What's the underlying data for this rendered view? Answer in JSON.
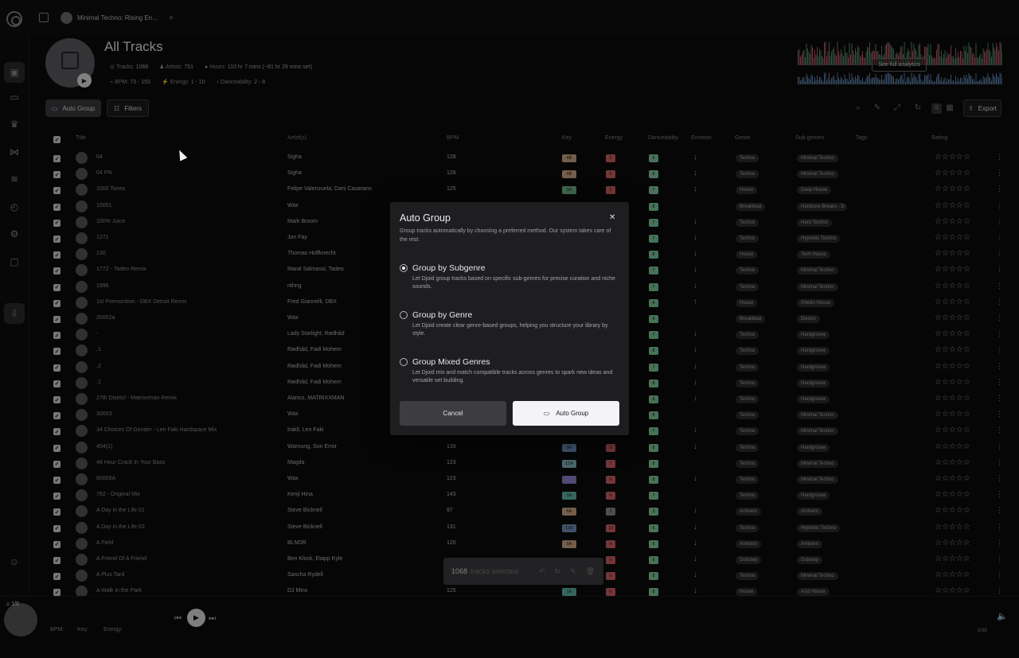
{
  "tab": {
    "label": "Minimal Techno: Rising En..."
  },
  "header": {
    "title": "All Tracks",
    "tracks_label": "Tracks:",
    "tracks": "1068",
    "artists_label": "Artists:",
    "artists": "751",
    "hours_label": "Hours:",
    "hours": "110 hr 7 mins (~81 hr 29 mins set)",
    "bpm_label": "BPM:",
    "bpm": "73 - 153",
    "energy_label": "Energy:",
    "energy": "1 - 10",
    "dance_label": "Danceability:",
    "dance": "2 - 8",
    "analytics": "See full analytics"
  },
  "toolbar": {
    "auto_group": "Auto Group",
    "filters": "Filters",
    "export": "Export"
  },
  "columns": {
    "title": "Title",
    "artist": "Artist(s)",
    "bpm": "BPM",
    "key": "Key",
    "energy": "Energy",
    "dance": "Danceability",
    "emotion": "Emotion",
    "genre": "Genre",
    "sub": "Sub-genres",
    "tags": "Tags",
    "rating": "Rating"
  },
  "rows": [
    {
      "title": "04",
      "artist": "Sigha",
      "bpm": "128",
      "key": "4B",
      "kc": "#c9a282",
      "energy": "5",
      "ec": "#c96060",
      "dance": "6",
      "emo": "↓",
      "genre": "Techno",
      "sub": "Minimal Techno"
    },
    {
      "title": "04 PN",
      "artist": "Sigha",
      "bpm": "128",
      "key": "4B",
      "kc": "#c9a282",
      "energy": "5",
      "ec": "#c96060",
      "dance": "6",
      "emo": "↓",
      "genre": "Techno",
      "sub": "Minimal Techno"
    },
    {
      "title": "1000 Tones",
      "artist": "Felipe Valenzuela,  Dani Casarano",
      "bpm": "125",
      "key": "3A",
      "kc": "#6fb48a",
      "energy": "5",
      "ec": "#c96060",
      "dance": "7",
      "emo": "↓",
      "genre": "House",
      "sub": "Deep House"
    },
    {
      "title": "10001",
      "artist": "Wax",
      "bpm": "",
      "key": "",
      "kc": "",
      "energy": "",
      "ec": "",
      "dance": "8",
      "emo": "",
      "genre": "Breakbeat",
      "sub": "Hardcore Breaks - D"
    },
    {
      "title": "100% Juice",
      "artist": "Mark Broom",
      "bpm": "",
      "key": "",
      "kc": "",
      "energy": "",
      "ec": "",
      "dance": "7",
      "emo": "↓",
      "genre": "Techno",
      "sub": "Hard Techno"
    },
    {
      "title": "1271",
      "artist": "Jon Fay",
      "bpm": "",
      "key": "",
      "kc": "",
      "energy": "",
      "ec": "",
      "dance": "7",
      "emo": "↓",
      "genre": "Techno",
      "sub": "Hypnotic Techno"
    },
    {
      "title": "130",
      "artist": "Thomas Hoffknecht",
      "bpm": "",
      "key": "",
      "kc": "",
      "energy": "",
      "ec": "",
      "dance": "8",
      "emo": "↓",
      "genre": "House",
      "sub": "Tech House"
    },
    {
      "title": "177Z - Tadeo Remix",
      "artist": "Maral Salmassi,  Tadeo",
      "bpm": "",
      "key": "",
      "kc": "",
      "energy": "",
      "ec": "",
      "dance": "7",
      "emo": "↓",
      "genre": "Techno",
      "sub": "Minimal Techno"
    },
    {
      "title": "1996",
      "artist": "nthng",
      "bpm": "",
      "key": "",
      "kc": "",
      "energy": "",
      "ec": "",
      "dance": "7",
      "emo": "↓",
      "genre": "Techno",
      "sub": "Minimal Techno"
    },
    {
      "title": "1st Premonition - DBX Detroit Remix",
      "artist": "Fred Giannelli,  DBX",
      "bpm": "",
      "key": "",
      "kc": "",
      "energy": "",
      "ec": "",
      "dance": "8",
      "emo": "↑",
      "genre": "House",
      "sub": "Ghetto House"
    },
    {
      "title": "20002a",
      "artist": "Wax",
      "bpm": "",
      "key": "",
      "kc": "",
      "energy": "",
      "ec": "",
      "dance": "8",
      "emo": "",
      "genre": "Breakbeat",
      "sub": "Electro"
    },
    {
      "title": "-",
      "artist": "Lady Starlight,  Rødhåd",
      "bpm": "",
      "key": "",
      "kc": "",
      "energy": "",
      "ec": "",
      "dance": "7",
      "emo": "↓",
      "genre": "Techno",
      "sub": "Hardgroove"
    },
    {
      "title": ".1",
      "artist": "Rødhåd,  Fadi Mohem",
      "bpm": "",
      "key": "",
      "kc": "",
      "energy": "",
      "ec": "",
      "dance": "8",
      "emo": "↓",
      "genre": "Techno",
      "sub": "Hardgroove"
    },
    {
      "title": ".2",
      "artist": "Rødhåd,  Fadi Mohem",
      "bpm": "",
      "key": "",
      "kc": "",
      "energy": "",
      "ec": "",
      "dance": "7",
      "emo": "↓",
      "genre": "Techno",
      "sub": "Hardgroove"
    },
    {
      "title": ".1",
      "artist": "Rødhåd,  Fadi Mohem",
      "bpm": "",
      "key": "",
      "kc": "",
      "energy": "",
      "ec": "",
      "dance": "8",
      "emo": "↓",
      "genre": "Techno",
      "sub": "Hardgroove"
    },
    {
      "title": "27th District - Matrixxman Remix",
      "artist": "Alarico,  MATRIXXMAN",
      "bpm": "",
      "key": "",
      "kc": "",
      "energy": "",
      "ec": "",
      "dance": "8",
      "emo": "↓",
      "genre": "Techno",
      "sub": "Hardgroove"
    },
    {
      "title": "30003",
      "artist": "Wax",
      "bpm": "",
      "key": "",
      "kc": "",
      "energy": "",
      "ec": "",
      "dance": "8",
      "emo": "",
      "genre": "Techno",
      "sub": "Minimal Techno"
    },
    {
      "title": "34 Choices Of Gender - Len Faki Hardspace Mix",
      "artist": "Irakli,  Len Faki",
      "bpm": "",
      "key": "",
      "kc": "",
      "energy": "",
      "ec": "",
      "dance": "7",
      "emo": "↓",
      "genre": "Techno",
      "sub": "Minimal Techno"
    },
    {
      "title": "404(1)",
      "artist": "Warnung,  Son Error",
      "bpm": "139",
      "key": "9E",
      "kc": "#6b8fb8",
      "energy": "6",
      "ec": "#c96060",
      "dance": "8",
      "emo": "↓",
      "genre": "Techno",
      "sub": "Hardgroove"
    },
    {
      "title": "48 Hour Crack In Your Bass",
      "artist": "Magda",
      "bpm": "123",
      "key": "12A",
      "kc": "#7fb0b8",
      "energy": "7",
      "ec": "#c96060",
      "dance": "8",
      "emo": "",
      "genre": "Techno",
      "sub": "Minimal Techno"
    },
    {
      "title": "60006A",
      "artist": "Wax",
      "bpm": "123",
      "key": "",
      "kc": "#8a7fc8",
      "energy": "6",
      "ec": "#c96060",
      "dance": "8",
      "emo": "↓",
      "genre": "Techno",
      "sub": "Minimal Techno"
    },
    {
      "title": "762 - Original Mix",
      "artist": "Kenji Hina",
      "bpm": "143",
      "key": "1A",
      "kc": "#5fb0a4",
      "energy": "6",
      "ec": "#c96060",
      "dance": "7",
      "emo": "",
      "genre": "Techno",
      "sub": "Hardgroove"
    },
    {
      "title": "A Day in the Life 01",
      "artist": "Steve Bicknell",
      "bpm": "97",
      "key": "6A",
      "kc": "#c9a282",
      "energy": "3",
      "ec": "#888888",
      "dance": "3",
      "emo": "↓",
      "genre": "Ambient",
      "sub": "Ambient"
    },
    {
      "title": "A Day in the Life 03",
      "artist": "Steve Bicknell",
      "bpm": "131",
      "key": "11B",
      "kc": "#6b8fb8",
      "energy": "10",
      "ec": "#c96060",
      "dance": "6",
      "emo": "↓",
      "genre": "Techno",
      "sub": "Hypnotic Techno"
    },
    {
      "title": "A Field",
      "artist": "BLNDR",
      "bpm": "120",
      "key": "5A",
      "kc": "#c9a282",
      "energy": "6",
      "ec": "#c96060",
      "dance": "6",
      "emo": "↓",
      "genre": "Ambient",
      "sub": "Ambient"
    },
    {
      "title": "A Friend Of A Friend",
      "artist": "Ben Klock,  Etapp Kyle",
      "bpm": "",
      "key": "",
      "kc": "",
      "energy": "6",
      "ec": "#c96060",
      "dance": "6",
      "emo": "↓",
      "genre": "Dubstep",
      "sub": "Dubstep"
    },
    {
      "title": "A Plus Tard",
      "artist": "Sascha Rydell",
      "bpm": "",
      "key": "",
      "kc": "",
      "energy": "6",
      "ec": "#c96060",
      "dance": "8",
      "emo": "↓",
      "genre": "Techno",
      "sub": "Minimal Techno"
    },
    {
      "title": "A Walk in the Park",
      "artist": "DJ Minx",
      "bpm": "125",
      "key": "1A",
      "kc": "#5fb0a4",
      "energy": "6",
      "ec": "#c96060",
      "dance": "8",
      "emo": "↓",
      "genre": "House",
      "sub": "Acid House"
    }
  ],
  "selection": {
    "count": "1068",
    "label": "tracks selected"
  },
  "player": {
    "track_counter": "1/0",
    "bpm_label": "BPM:",
    "key_label": "Key:",
    "energy_label": "Energy:",
    "time": "0:00"
  },
  "modal": {
    "title": "Auto Group",
    "description": "Group tracks automatically by choosing a preferred method. Our system takes care of the rest.",
    "options": [
      {
        "label": "Group by Subgenre",
        "desc": "Let Djoid group tracks based on specific sub-genres for precise curation and niche sounds.",
        "selected": true
      },
      {
        "label": "Group by Genre",
        "desc": "Let Djoid create clear genre-based groups, helping you structure your library by style.",
        "selected": false
      },
      {
        "label": "Group Mixed Genres",
        "desc": "Let Djoid mix and match compatible tracks across genres to spark new ideas and versatile set building.",
        "selected": false
      }
    ],
    "cancel": "Cancel",
    "confirm": "Auto Group"
  },
  "colors": {
    "dance": "#7fc79a",
    "accent": "#f4f4f6"
  }
}
